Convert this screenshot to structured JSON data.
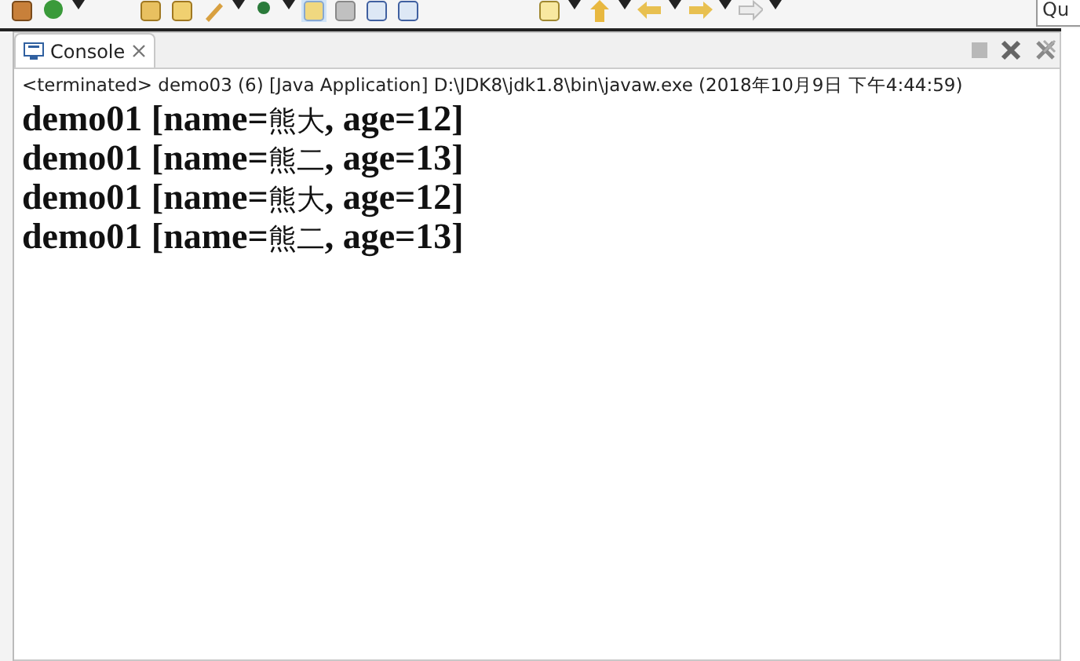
{
  "quick_access": {
    "placeholder": "Qu"
  },
  "tabs": [
    {
      "label": "Console",
      "selected": true
    }
  ],
  "console": {
    "status": "<terminated> demo03 (6) [Java Application] D:\\JDK8\\jdk1.8\\bin\\javaw.exe (2018年10月9日 下午4:44:59)",
    "lines": [
      "demo01 [name=熊大, age=12]",
      "demo01 [name=熊二, age=13]",
      "demo01 [name=熊大, age=12]",
      "demo01 [name=熊二, age=13]"
    ]
  }
}
